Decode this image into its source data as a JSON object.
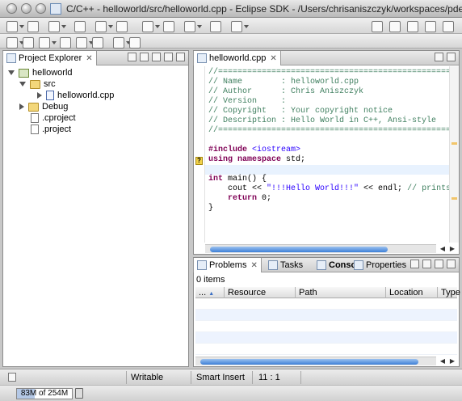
{
  "window": {
    "title": "C/C++ - helloworld/src/helloworld.cpp - Eclipse SDK - /Users/chrisaniszczyk/workspaces/pde"
  },
  "toolbar1": {
    "buttons": [
      "new-icon",
      "save-icon",
      "print-icon",
      "new-cpp-project-icon",
      "new-folder-icon",
      "new-class-icon",
      "run-target-icon",
      "build-icon",
      "debug-icon",
      "run-icon",
      "external-tools-icon",
      "open-type-icon",
      "search-icon",
      "open-perspective-icon",
      "cpp-perspective-icon",
      "debug-perspective-icon"
    ]
  },
  "toolbar2": {
    "buttons": [
      "toggle-mark-occurrences-icon",
      "show-whitespace-icon",
      "toggle-block-icon",
      "next-annotation-icon",
      "prev-annotation-icon",
      "last-edit-icon",
      "back-icon",
      "forward-icon"
    ]
  },
  "explorer": {
    "tab_label": "Project Explorer",
    "close": "✕",
    "tree": [
      {
        "label": "helloworld",
        "icon": "project",
        "twisty": "open"
      },
      {
        "label": "src",
        "icon": "folder",
        "twisty": "open"
      },
      {
        "label": "helloworld.cpp",
        "icon": "cfile",
        "twisty": "closed"
      },
      {
        "label": "Debug",
        "icon": "folder",
        "twisty": "closed"
      },
      {
        "label": ".cproject",
        "icon": "file",
        "twisty": "none"
      },
      {
        "label": ".project",
        "icon": "file",
        "twisty": "none"
      }
    ]
  },
  "editor": {
    "tab_label": "helloworld.cpp",
    "close": "✕",
    "lines": [
      {
        "parts": [
          {
            "t": "//=======================================================",
            "c": "c-comment"
          }
        ]
      },
      {
        "parts": [
          {
            "t": "// Name        : helloworld.cpp",
            "c": "c-comment"
          }
        ]
      },
      {
        "parts": [
          {
            "t": "// Author      : Chris Aniszczyk",
            "c": "c-comment"
          }
        ]
      },
      {
        "parts": [
          {
            "t": "// Version     :",
            "c": "c-comment"
          }
        ]
      },
      {
        "parts": [
          {
            "t": "// Copyright   : Your copyright notice",
            "c": "c-comment"
          }
        ]
      },
      {
        "parts": [
          {
            "t": "// Description : Hello World in C++, Ansi-style",
            "c": "c-comment"
          }
        ]
      },
      {
        "parts": [
          {
            "t": "//=======================================================",
            "c": "c-comment"
          }
        ]
      },
      {
        "parts": [
          {
            "t": "",
            "c": ""
          }
        ]
      },
      {
        "parts": [
          {
            "t": "#include ",
            "c": "c-kw"
          },
          {
            "t": "<iostream>",
            "c": "c-inc"
          }
        ]
      },
      {
        "parts": [
          {
            "t": "using namespace ",
            "c": "c-kw"
          },
          {
            "t": "std;",
            "c": ""
          }
        ]
      },
      {
        "parts": [
          {
            "t": "",
            "c": ""
          }
        ]
      },
      {
        "parts": [
          {
            "t": "int ",
            "c": "c-kw"
          },
          {
            "t": "main() {",
            "c": ""
          }
        ]
      },
      {
        "parts": [
          {
            "t": "    cout << ",
            "c": ""
          },
          {
            "t": "\"!!!Hello World!!!\"",
            "c": "c-str"
          },
          {
            "t": " << endl; ",
            "c": ""
          },
          {
            "t": "// prints !!",
            "c": "c-comment"
          }
        ]
      },
      {
        "parts": [
          {
            "t": "    ",
            "c": ""
          },
          {
            "t": "return ",
            "c": "c-kw"
          },
          {
            "t": "0;",
            "c": ""
          }
        ]
      },
      {
        "parts": [
          {
            "t": "}",
            "c": ""
          }
        ]
      }
    ],
    "gutter_marker": "?",
    "scroll_arrows": [
      "◀",
      "▶"
    ]
  },
  "bottom": {
    "tabs": [
      {
        "label": "Problems",
        "name": "tab-problems",
        "active": true
      },
      {
        "label": "Tasks",
        "name": "tab-tasks",
        "active": false
      },
      {
        "label": "Console",
        "name": "tab-console",
        "active": false
      },
      {
        "label": "Properties",
        "name": "tab-properties",
        "active": false
      }
    ],
    "close": "✕",
    "count": "0 items",
    "columns": [
      "...",
      "Resource",
      "Path",
      "Location",
      "Type"
    ],
    "sort_indicator": "▲",
    "scroll_arrows": [
      "◀",
      "▶"
    ]
  },
  "status": {
    "writable": "Writable",
    "insert_mode": "Smart Insert",
    "position": "11 : 1",
    "heap": "83M of 254M",
    "heap_fraction": 0.327
  }
}
